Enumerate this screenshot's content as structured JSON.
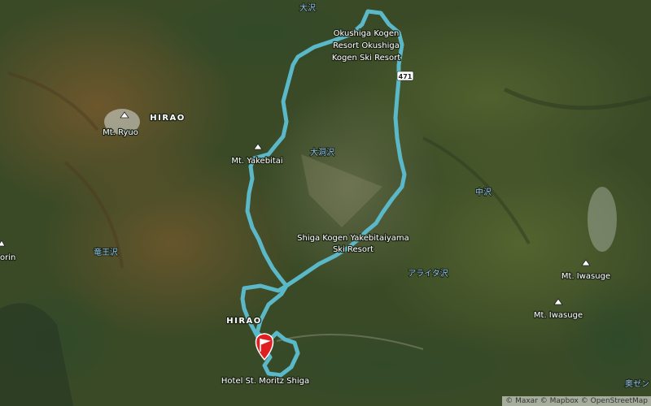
{
  "map": {
    "labels": {
      "osawa": "大沢",
      "okushiga": "Okushiga Kogen Resort Okushiga Kogen Ski Resort",
      "okushiga_1": "Okushiga Kogen",
      "okushiga_2": "Resort Okushiga",
      "okushiga_3": "Kogen Ski Resort",
      "road": "471",
      "hirao_top": "HIRAO",
      "mt_ryuo": "Mt. Ryuo",
      "mt_yakebitai": "Mt. Yakebitai",
      "odohora": "大洞沢",
      "nakazawa": "中沢",
      "ryuo_sawa": "竜王沢",
      "orin": "orin",
      "shiga_resort_1": "Shiga Kogen Yakebitaiyama",
      "shiga_resort_2": "Ski Resort",
      "araita": "アライタ沢",
      "mt_iwasuge_1": "Mt. Iwasuge",
      "mt_iwasuge_2": "Mt. Iwasuge",
      "hirao_bottom": "HIRAO",
      "hotel": "Hotel St. Moritz Shiga",
      "okuzen": "奥ゼン"
    },
    "route_color": "#5bb8c8",
    "marker_color": "#e02020",
    "attribution": "© Maxar © Mapbox © OpenStreetMap"
  }
}
